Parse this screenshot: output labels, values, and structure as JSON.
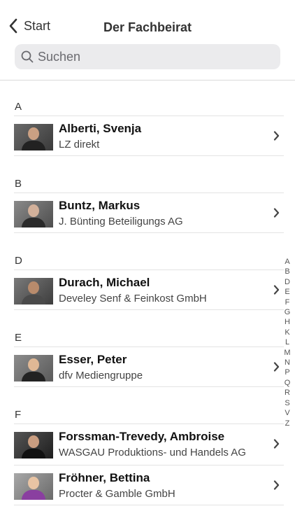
{
  "nav": {
    "back_label": "Start",
    "title": "Der Fachbeirat"
  },
  "search": {
    "placeholder": "Suchen"
  },
  "sections": [
    {
      "letter": "A",
      "people": [
        {
          "name": "Alberti, Svenja",
          "company": "LZ direkt"
        }
      ]
    },
    {
      "letter": "B",
      "people": [
        {
          "name": "Buntz, Markus",
          "company": "J. Bünting Beteiligungs AG"
        }
      ]
    },
    {
      "letter": "D",
      "people": [
        {
          "name": "Durach, Michael",
          "company": "Develey Senf & Feinkost GmbH"
        }
      ]
    },
    {
      "letter": "E",
      "people": [
        {
          "name": "Esser, Peter",
          "company": "dfv Mediengruppe"
        }
      ]
    },
    {
      "letter": "F",
      "people": [
        {
          "name": "Forssman-Trevedy, Ambroise",
          "company": "WASGAU Produktions- und Handels AG"
        },
        {
          "name": "Fröhner, Bettina",
          "company": "Procter & Gamble GmbH"
        }
      ]
    }
  ],
  "index_letters": [
    "A",
    "B",
    "D",
    "E",
    "F",
    "G",
    "H",
    "K",
    "L",
    "M",
    "N",
    "P",
    "Q",
    "R",
    "S",
    "V",
    "Z"
  ],
  "colors": {
    "search_bg": "#ebebed",
    "divider": "#e3e3e3",
    "text": "#111111"
  }
}
